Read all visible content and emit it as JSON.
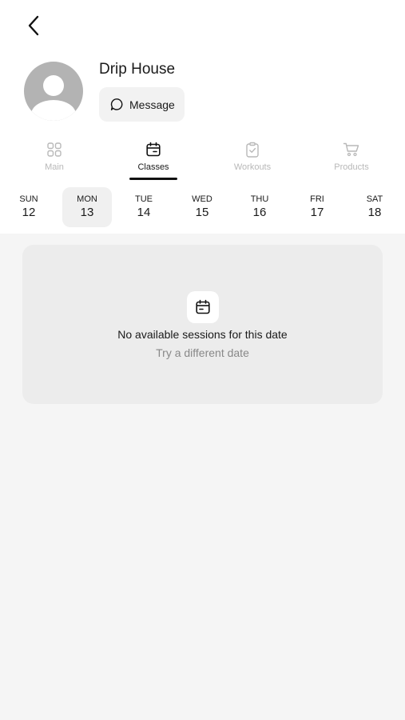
{
  "profile": {
    "name": "Drip House",
    "message_label": "Message"
  },
  "tabs": [
    {
      "label": "Main",
      "icon": "grid-icon",
      "active": false
    },
    {
      "label": "Classes",
      "icon": "calendar-icon",
      "active": true
    },
    {
      "label": "Workouts",
      "icon": "clipboard-check-icon",
      "active": false
    },
    {
      "label": "Products",
      "icon": "cart-icon",
      "active": false
    }
  ],
  "days": [
    {
      "name": "SUN",
      "date": "12",
      "selected": false
    },
    {
      "name": "MON",
      "date": "13",
      "selected": true
    },
    {
      "name": "TUE",
      "date": "14",
      "selected": false
    },
    {
      "name": "WED",
      "date": "15",
      "selected": false
    },
    {
      "name": "THU",
      "date": "16",
      "selected": false
    },
    {
      "name": "FRI",
      "date": "17",
      "selected": false
    },
    {
      "name": "SAT",
      "date": "18",
      "selected": false
    }
  ],
  "empty_state": {
    "title": "No available sessions for this date",
    "subtitle": "Try a different date"
  }
}
